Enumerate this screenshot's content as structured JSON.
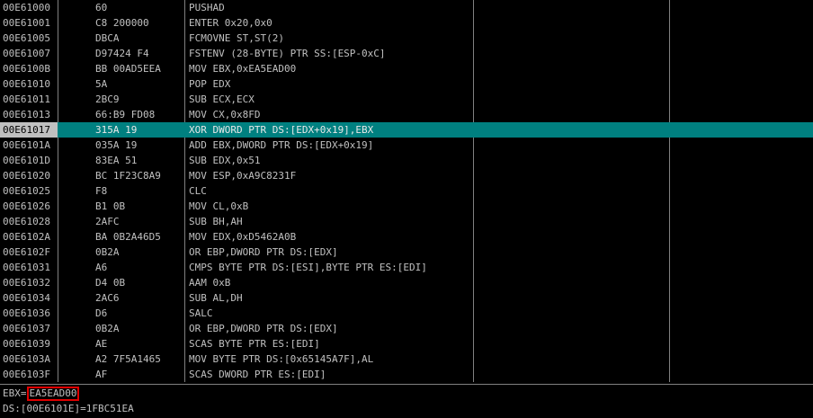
{
  "disassembly": {
    "rows": [
      {
        "address": "00E61000",
        "hex": "60",
        "instruction": "PUSHAD"
      },
      {
        "address": "00E61001",
        "hex": "C8 200000",
        "instruction": "ENTER 0x20,0x0"
      },
      {
        "address": "00E61005",
        "hex": "DBCA",
        "instruction": "FCMOVNE ST,ST(2)"
      },
      {
        "address": "00E61007",
        "hex": "D97424 F4",
        "instruction": "FSTENV (28-BYTE) PTR SS:[ESP-0xC]"
      },
      {
        "address": "00E6100B",
        "hex": "BB 00AD5EEA",
        "instruction": "MOV EBX,0xEA5EAD00"
      },
      {
        "address": "00E61010",
        "hex": "5A",
        "instruction": "POP EDX"
      },
      {
        "address": "00E61011",
        "hex": "2BC9",
        "instruction": "SUB ECX,ECX"
      },
      {
        "address": "00E61013",
        "hex": "66:B9 FD08",
        "instruction": "MOV CX,0x8FD"
      },
      {
        "address": "00E61017",
        "hex": "315A 19",
        "instruction": "XOR DWORD PTR DS:[EDX+0x19],EBX",
        "selected": true
      },
      {
        "address": "00E6101A",
        "hex": "035A 19",
        "instruction": "ADD EBX,DWORD PTR DS:[EDX+0x19]"
      },
      {
        "address": "00E6101D",
        "hex": "83EA 51",
        "instruction": "SUB EDX,0x51"
      },
      {
        "address": "00E61020",
        "hex": "BC 1F23C8A9",
        "instruction": "MOV ESP,0xA9C8231F"
      },
      {
        "address": "00E61025",
        "hex": "F8",
        "instruction": "CLC"
      },
      {
        "address": "00E61026",
        "hex": "B1 0B",
        "instruction": "MOV CL,0xB"
      },
      {
        "address": "00E61028",
        "hex": "2AFC",
        "instruction": "SUB BH,AH"
      },
      {
        "address": "00E6102A",
        "hex": "BA 0B2A46D5",
        "instruction": "MOV EDX,0xD5462A0B"
      },
      {
        "address": "00E6102F",
        "hex": "0B2A",
        "instruction": "OR EBP,DWORD PTR DS:[EDX]"
      },
      {
        "address": "00E61031",
        "hex": "A6",
        "instruction": "CMPS BYTE PTR DS:[ESI],BYTE PTR ES:[EDI]"
      },
      {
        "address": "00E61032",
        "hex": "D4 0B",
        "instruction": "AAM 0xB"
      },
      {
        "address": "00E61034",
        "hex": "2AC6",
        "instruction": "SUB AL,DH"
      },
      {
        "address": "00E61036",
        "hex": "D6",
        "instruction": "SALC"
      },
      {
        "address": "00E61037",
        "hex": "0B2A",
        "instruction": "OR EBP,DWORD PTR DS:[EDX]"
      },
      {
        "address": "00E61039",
        "hex": "AE",
        "instruction": "SCAS BYTE PTR ES:[EDI]"
      },
      {
        "address": "00E6103A",
        "hex": "A2 7F5A1465",
        "instruction": "MOV BYTE PTR DS:[0x65145A7F],AL"
      },
      {
        "address": "00E6103F",
        "hex": "AF",
        "instruction": "SCAS DWORD PTR ES:[EDI]"
      }
    ]
  },
  "info": {
    "ebx_label": "EBX=",
    "ebx_value": "EA5EAD00",
    "ds_line": "DS:[00E6101E]=1FBC51EA"
  },
  "colors": {
    "background": "#000000",
    "text": "#c0c0c0",
    "selection": "#008080",
    "highlight_box": "#e00000"
  }
}
